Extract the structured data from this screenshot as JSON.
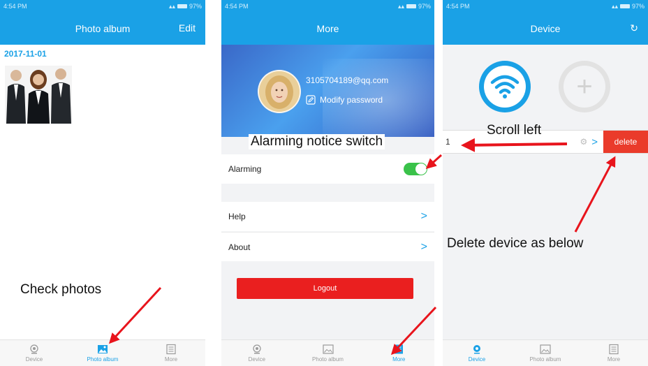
{
  "status_bar": {
    "time": "4:54 PM",
    "battery": "97%"
  },
  "screens": {
    "photo_album": {
      "title": "Photo album",
      "edit_label": "Edit",
      "date": "2017-11-01"
    },
    "more": {
      "title": "More",
      "email": "3105704189@qq.com",
      "modify_password": "Modify password",
      "alarming_label": "Alarming",
      "alarming_on": true,
      "help_label": "Help",
      "about_label": "About",
      "logout_label": "Logout"
    },
    "device": {
      "title": "Device",
      "device_name_fragment": "1",
      "delete_label": "delete"
    }
  },
  "tabs": {
    "device": "Device",
    "photo_album": "Photo album",
    "more": "More"
  },
  "annotations": {
    "check_photos": "Check photos",
    "alarming_notice_switch": "Alarming notice switch",
    "scroll_left": "Scroll left",
    "delete_device": "Delete device as below"
  },
  "colors": {
    "accent": "#1aa1e6",
    "logout": "#ea1f1f",
    "delete": "#ea3b2b",
    "toggle_on": "#3ac24a",
    "arrow": "#e8141c"
  }
}
